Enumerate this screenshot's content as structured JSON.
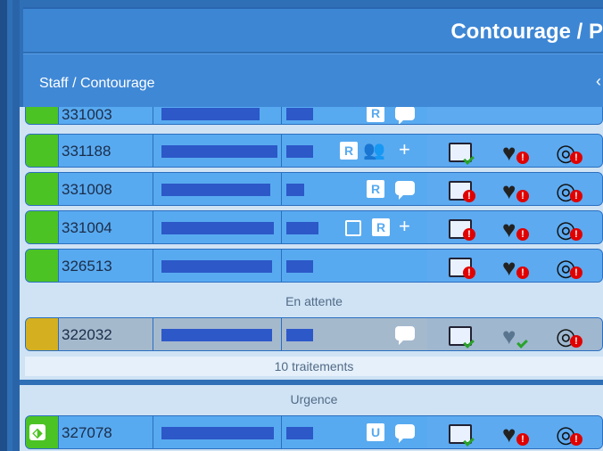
{
  "header": {
    "title": "Contourage / P"
  },
  "subheader": {
    "title": "Staff / Contourage",
    "collapse_icon": "chevron-left-icon"
  },
  "rows_top": [
    {
      "id": "331003",
      "status": "green"
    },
    {
      "id": "331188",
      "status": "green"
    },
    {
      "id": "331008",
      "status": "green"
    },
    {
      "id": "331004",
      "status": "green"
    },
    {
      "id": "326513",
      "status": "green"
    }
  ],
  "waiting_label": "En attente",
  "waiting_row": {
    "id": "322032",
    "status": "yellow"
  },
  "treatment_count": "10   traitements",
  "urgent_label": "Urgence",
  "urgent_row": {
    "id": "327078",
    "status": "green"
  },
  "badges": {
    "R": "R",
    "U": "U",
    "plus": "+"
  },
  "colors": {
    "accent": "#3d86d4",
    "row": "#58aaf0",
    "green": "#4cc324",
    "yellow": "#d4b020",
    "alert": "#e00000"
  }
}
